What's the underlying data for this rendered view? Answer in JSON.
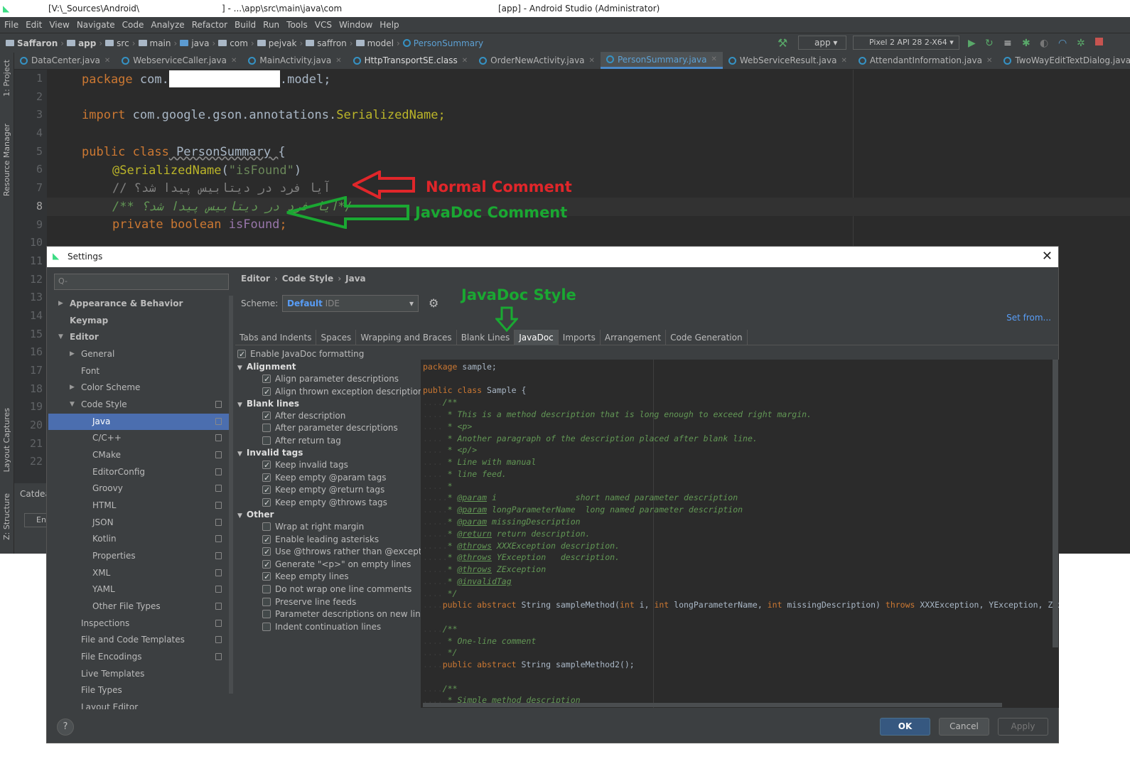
{
  "window": {
    "title_path": "[V:\\_Sources\\Android\\",
    "title_mid": "] - ...\\app\\src\\main\\java\\com",
    "title_app": "[app] - Android Studio (Administrator)"
  },
  "menu": [
    "File",
    "Edit",
    "View",
    "Navigate",
    "Code",
    "Analyze",
    "Refactor",
    "Build",
    "Run",
    "Tools",
    "VCS",
    "Window",
    "Help"
  ],
  "breadcrumbs": [
    "Saffaron",
    "app",
    "src",
    "main",
    "java",
    "com",
    "pejvak",
    "saffron",
    "model",
    "PersonSummary"
  ],
  "run_config": "app",
  "device": "Pixel 2 API 28 2-X64",
  "tabs": [
    "DataCenter.java",
    "WebserviceCaller.java",
    "MainActivity.java",
    "HttpTransportSE.class",
    "OrderNewActivity.java",
    "PersonSummary.java",
    "WebServiceResult.java",
    "AttendantInformation.java",
    "TwoWayEditTextDialog.java"
  ],
  "side_labels": {
    "project": "1: Project",
    "resource": "Resource Manager",
    "layout": "Layout Captures",
    "structure": "Z: Structure",
    "cat": "Catdea",
    "en": "En"
  },
  "line_numbers": [
    "1",
    "2",
    "3",
    "4",
    "5",
    "6",
    "7",
    "8",
    "9",
    "10",
    "11",
    "12",
    "13",
    "14",
    "15",
    "16",
    "17",
    "18",
    "19",
    "20",
    "21",
    "22"
  ],
  "code": {
    "l1a": "package",
    "l1b": " com.",
    "l1c": ".model;",
    "l3a": "import",
    "l3b": " com.google.gson.annotations.",
    "l3c": "SerializedName;",
    "l5a": "public class",
    "l5b": " PersonSummary ",
    "l5c": "{",
    "l6a": "@SerializedName",
    "l6b": "(",
    "l6c": "\"isFound\"",
    "l6d": ")",
    "l7": "// آیا فرد در دیتابیس پیدا شد؟",
    "l8": "/** آیا فرد در دیتابیس پیدا شد؟*/",
    "l9a": "private boolean",
    "l9b": " isFound",
    ";": ";"
  },
  "annotations": {
    "normal": "Normal Comment",
    "javadoc": "JavaDoc Comment",
    "style": "JavaDoc Style"
  },
  "colors": {
    "red": "#e0262a",
    "green": "#1aa832"
  },
  "settings": {
    "title": "Settings",
    "search_placeholder": "Q-",
    "tree": [
      "Appearance & Behavior",
      "Keymap",
      "Editor",
      "General",
      "Font",
      "Color Scheme",
      "Code Style",
      "Java",
      "C/C++",
      "CMake",
      "EditorConfig",
      "Groovy",
      "HTML",
      "JSON",
      "Kotlin",
      "Properties",
      "XML",
      "YAML",
      "Other File Types",
      "Inspections",
      "File and Code Templates",
      "File Encodings",
      "Live Templates",
      "File Types",
      "Layout Editor"
    ],
    "breadcrumb": [
      "Editor",
      "Code Style",
      "Java"
    ],
    "scheme_label": "Scheme:",
    "scheme_value": "Default",
    "scheme_sub": "IDE",
    "set_from": "Set from...",
    "tabs": [
      "Tabs and Indents",
      "Spaces",
      "Wrapping and Braces",
      "Blank Lines",
      "JavaDoc",
      "Imports",
      "Arrangement",
      "Code Generation"
    ],
    "enable": "Enable JavaDoc formatting",
    "groups": {
      "alignment": "Alignment",
      "blank": "Blank lines",
      "invalid": "Invalid tags",
      "other": "Other"
    },
    "options": [
      {
        "label": "Align parameter descriptions",
        "on": true
      },
      {
        "label": "Align thrown exception descriptions",
        "on": true
      },
      {
        "label": "After description",
        "on": true
      },
      {
        "label": "After parameter descriptions",
        "on": false
      },
      {
        "label": "After return tag",
        "on": false
      },
      {
        "label": "Keep invalid tags",
        "on": true
      },
      {
        "label": "Keep empty @param tags",
        "on": true
      },
      {
        "label": "Keep empty @return tags",
        "on": true
      },
      {
        "label": "Keep empty @throws tags",
        "on": true
      },
      {
        "label": "Wrap at right margin",
        "on": false
      },
      {
        "label": "Enable leading asterisks",
        "on": true
      },
      {
        "label": "Use @throws rather than @exception",
        "on": true
      },
      {
        "label": "Generate \"<p>\" on empty lines",
        "on": true
      },
      {
        "label": "Keep empty lines",
        "on": true
      },
      {
        "label": "Do not wrap one line comments",
        "on": false
      },
      {
        "label": "Preserve line feeds",
        "on": false
      },
      {
        "label": "Parameter descriptions on new line",
        "on": false
      },
      {
        "label": "Indent continuation lines",
        "on": false
      }
    ],
    "preview": {
      "p1a": "package",
      "p1b": " sample;",
      "p2a": "public class",
      "p2b": " Sample {",
      "c1": "/**",
      "c2": " * This is a method description that is long enough to exceed right margin.",
      "c3": " * <p>",
      "c4": " * Another paragraph of the description placed after blank line.",
      "c5": " * <p/>",
      "c6": " * Line with manual",
      "c7": " * line feed.",
      "c8": " *",
      "t1": "@param",
      "t1b": " i                short named parameter description",
      "t2": "@param",
      "t2b": " longParameterName  long named parameter description",
      "t3": "@param",
      "t3b": " missingDescription",
      "t4": "@return",
      "t4b": " return description.",
      "t5": "@throws",
      "t5b": " XXXException description.",
      "t6": "@throws",
      "t6b": " YException   description.",
      "t7": "@throws",
      "t7b": " ZException",
      "t8": "@invalidTag",
      "c9": " */",
      "m1a": "public abstract",
      "m1b": " String sampleMethod(",
      "m1c": "int",
      "m1d": " i, ",
      "m1e": "int",
      "m1f": " longParameterName, ",
      "m1g": "int",
      "m1h": " missingDescription) ",
      "m1i": "throws",
      "m1j": " XXXException, YException, ZEx",
      "c10": "/**",
      "c11": " * One-line comment",
      "c12": " */",
      "m2a": "public abstract",
      "m2b": " String sampleMethod2();",
      "c13": "/**",
      "c14": " * Simple method description"
    },
    "buttons": {
      "ok": "OK",
      "cancel": "Cancel",
      "apply": "Apply",
      "help": "?"
    }
  }
}
